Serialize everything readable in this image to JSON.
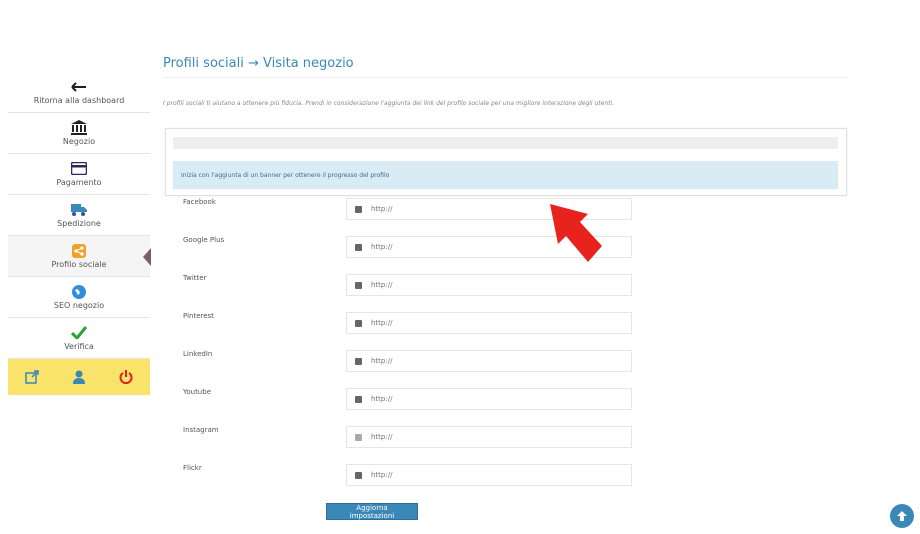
{
  "colors": {
    "accent": "#3a88b8",
    "footer_bg": "#f9e36a",
    "alert_bg": "#d9ecf5",
    "arrow": "#e8231e"
  },
  "sidebar": {
    "items": [
      {
        "label": "Ritorna alla dashboard",
        "icon": "arrow-left-icon"
      },
      {
        "label": "Negozio",
        "icon": "bank-icon"
      },
      {
        "label": "Pagamento",
        "icon": "card-icon"
      },
      {
        "label": "Spedizione",
        "icon": "truck-icon"
      },
      {
        "label": "Profilo sociale",
        "icon": "share-icon"
      },
      {
        "label": "SEO negozio",
        "icon": "globe-icon"
      },
      {
        "label": "Verifica",
        "icon": "check-icon"
      }
    ],
    "active_index": 4,
    "footer_icons": [
      "external-link-icon",
      "user-icon",
      "power-icon"
    ]
  },
  "main": {
    "title": "Profili sociali → Visita negozio",
    "intro": "I profili sociali ti aiutano a ottenere più fiducia. Prendi in considerazione l'aggiunta dei link del profilo sociale per una migliore interazione degli utenti.",
    "banner_alert": "Inizia con l'aggiunta di un banner per ottenere il progresso del profilo",
    "social": [
      {
        "label": "Facebook",
        "placeholder": "http://"
      },
      {
        "label": "Google Plus",
        "placeholder": "http://"
      },
      {
        "label": "Twitter",
        "placeholder": "http://"
      },
      {
        "label": "Pinterest",
        "placeholder": "http://"
      },
      {
        "label": "LinkedIn",
        "placeholder": "http://"
      },
      {
        "label": "Youtube",
        "placeholder": "http://"
      },
      {
        "label": "Instagram",
        "placeholder": "http://"
      },
      {
        "label": "Flickr",
        "placeholder": "http://"
      }
    ],
    "save_label": "Aggiorna impostazioni"
  }
}
